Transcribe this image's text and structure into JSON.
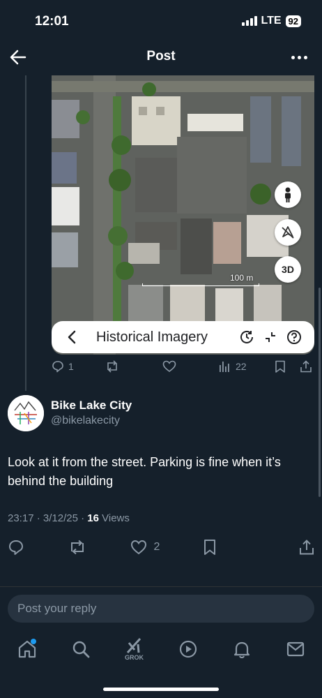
{
  "status_bar": {
    "time": "12:01",
    "network": "LTE",
    "battery": "92"
  },
  "header": {
    "title": "Post"
  },
  "map_card": {
    "scale_label": "100 m",
    "control_3d": "3D",
    "historical_title": "Historical Imagery",
    "stats": {
      "replies": "1",
      "views": "22"
    }
  },
  "author": {
    "name": "Bike Lake City",
    "handle": "@bikelakecity"
  },
  "post": {
    "text": "Look at it from the street. Parking is fine when it’s behind the building",
    "time": "23:17",
    "date": "3/12/25",
    "views_count": "16",
    "views_label": "Views",
    "likes": "2"
  },
  "reply": {
    "placeholder": "Post your reply"
  },
  "nav": {
    "grok_label": "GROK"
  },
  "colors": {
    "background": "#15202b",
    "accent": "#1d9bf0",
    "muted": "#8b98a5"
  }
}
